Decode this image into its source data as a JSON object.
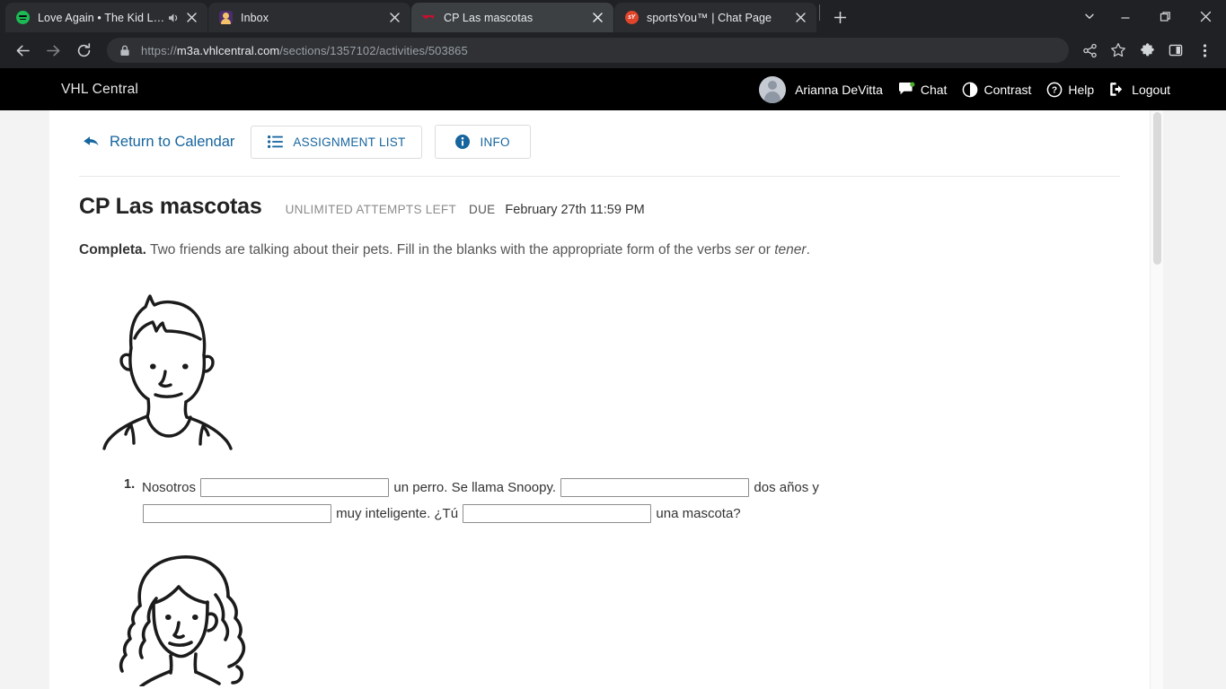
{
  "browser": {
    "tabs": [
      {
        "title": "Love Again • The Kid LAROI",
        "favicon": "spotify-icon",
        "audio": true,
        "active": false
      },
      {
        "title": "Inbox",
        "favicon": "inbox-icon",
        "audio": false,
        "active": false
      },
      {
        "title": "CP Las mascotas",
        "favicon": "vhl-icon",
        "audio": false,
        "active": true
      },
      {
        "title": "sportsYou™ | Chat Page",
        "favicon": "sportsyou-icon",
        "audio": false,
        "active": false
      }
    ],
    "new_tab_label": "+",
    "tab_search_icon": "chevron-down-icon",
    "window_controls": {
      "minimize": "minimize-icon",
      "maximize": "maximize-icon",
      "close": "close-icon"
    },
    "nav": {
      "back": "back-arrow-icon",
      "forward": "forward-arrow-icon",
      "reload": "reload-icon"
    },
    "omnibox": {
      "lock_icon": "lock-icon",
      "scheme": "https://",
      "host": "m3a.vhlcentral.com",
      "path": "/sections/1357102/activities/503865"
    },
    "actions": {
      "share": "share-icon",
      "bookmark": "star-icon",
      "extensions": "puzzle-icon",
      "sidepanel": "side-panel-icon",
      "menu": "kebab-menu-icon"
    }
  },
  "site": {
    "logo": "VHL Central",
    "user_name": "Arianna DeVitta",
    "links": [
      {
        "label": "Chat",
        "icon": "chat-bubble-icon"
      },
      {
        "label": "Contrast",
        "icon": "contrast-icon"
      },
      {
        "label": "Help",
        "icon": "help-circle-icon"
      },
      {
        "label": "Logout",
        "icon": "logout-icon"
      }
    ]
  },
  "toolbar": {
    "return_label": "Return to Calendar",
    "return_icon": "back-arrow-icon",
    "assignment_list_label": "ASSIGNMENT LIST",
    "assignment_list_icon": "list-icon",
    "info_label": "INFO",
    "info_icon": "info-circle-icon"
  },
  "activity": {
    "title": "CP Las mascotas",
    "attempts": "UNLIMITED ATTEMPTS LEFT",
    "due_label": "DUE",
    "due_date": "February 27th 11:59 PM",
    "instruction_lead": "Completa.",
    "instruction_part1": " Two friends are talking about their pets. Fill in the blanks with the appropriate form of the verbs ",
    "instruction_verb1": "ser",
    "instruction_joiner": " or ",
    "instruction_verb2": "tener",
    "instruction_end": "."
  },
  "question": {
    "number": "1.",
    "seg1": "Nosotros",
    "seg2": "un perro. Se llama Snoopy.",
    "seg3": "dos años y",
    "seg4": "muy inteligente. ¿Tú",
    "seg5": "una mascota?",
    "blank_values": [
      "",
      "",
      "",
      ""
    ],
    "blank_placeholder": ""
  },
  "illustrations": [
    {
      "name": "boy-portrait-illustration",
      "alt": "Line drawing of a boy smiling"
    },
    {
      "name": "girl-portrait-illustration",
      "alt": "Line drawing of a girl with long wavy hair"
    }
  ],
  "colors": {
    "link_blue": "#16659e",
    "header_black": "#000000",
    "chrome_dark": "#202124",
    "active_tab": "#3c4043"
  }
}
